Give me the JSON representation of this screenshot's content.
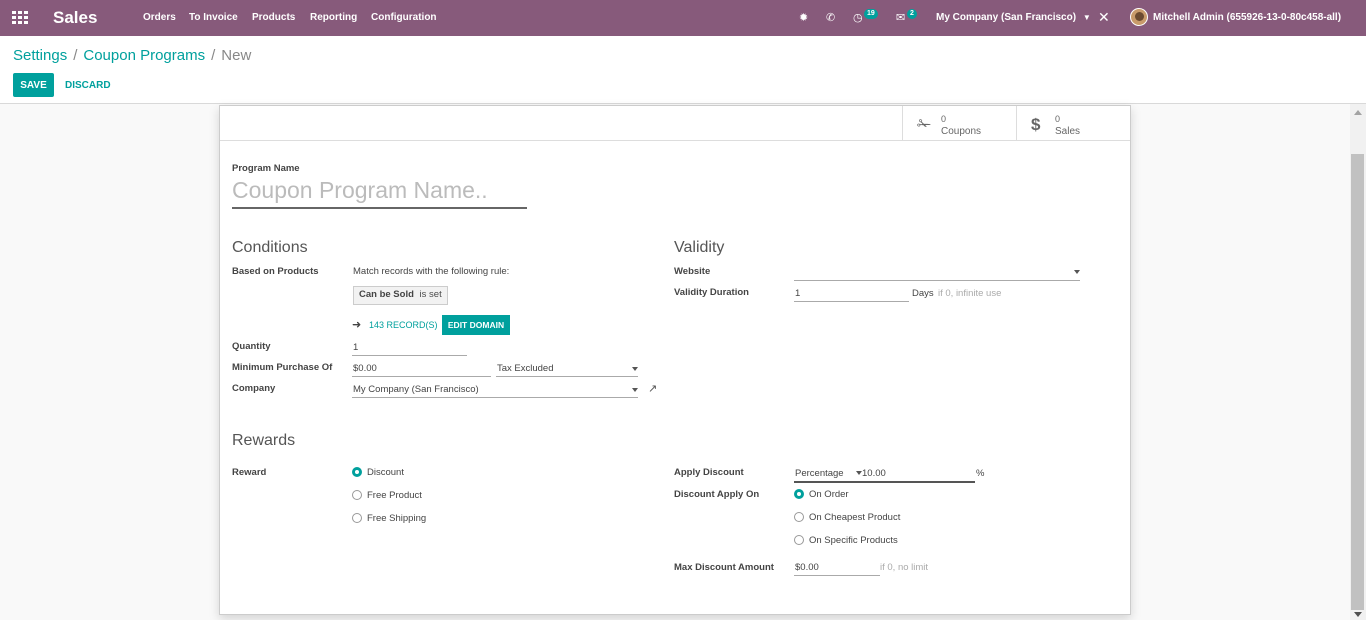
{
  "navbar": {
    "brand": "Sales",
    "menu": [
      "Orders",
      "To Invoice",
      "Products",
      "Reporting",
      "Configuration"
    ],
    "activities_count": "19",
    "messages_count": "2",
    "company": "My Company (San Francisco)",
    "user": "Mitchell Admin (655926-13-0-80c458-all)",
    "background_color": "#875a7b"
  },
  "breadcrumb": {
    "items": [
      "Settings",
      "Coupon Programs"
    ],
    "current": "New"
  },
  "toolbar": {
    "save_label": "SAVE",
    "discard_label": "DISCARD",
    "accent_color": "#00a09d"
  },
  "stats": {
    "coupons_value": "0",
    "coupons_label": "Coupons",
    "sales_value": "0",
    "sales_label": "Sales"
  },
  "form": {
    "program_name_label": "Program Name",
    "program_name_placeholder": "Coupon Program Name..",
    "conditions": {
      "title": "Conditions",
      "based_on_products_label": "Based on Products",
      "rule_text": "Match records with the following rule:",
      "rule_field": "Can be Sold",
      "rule_operator": "is set",
      "records_link": "143 RECORD(S)",
      "edit_domain_label": "EDIT DOMAIN",
      "quantity_label": "Quantity",
      "quantity_value": "1",
      "min_purchase_label": "Minimum Purchase Of",
      "min_purchase_value": "$0.00",
      "tax_option": "Tax Excluded",
      "company_label": "Company",
      "company_value": "My Company (San Francisco)"
    },
    "validity": {
      "title": "Validity",
      "website_label": "Website",
      "website_value": "",
      "duration_label": "Validity Duration",
      "duration_value": "1",
      "duration_unit": "Days",
      "duration_hint": "if 0, infinite use"
    },
    "rewards": {
      "title": "Rewards",
      "reward_label": "Reward",
      "reward_options": [
        "Discount",
        "Free Product",
        "Free Shipping"
      ],
      "reward_selected": "Discount",
      "apply_discount_label": "Apply Discount",
      "discount_type": "Percentage",
      "discount_value": "10.00",
      "discount_unit": "%",
      "apply_on_label": "Discount Apply On",
      "apply_on_options": [
        "On Order",
        "On Cheapest Product",
        "On Specific Products"
      ],
      "apply_on_selected": "On Order",
      "max_discount_label": "Max Discount Amount",
      "max_discount_value": "$0.00",
      "max_discount_hint": "if 0, no limit"
    }
  }
}
